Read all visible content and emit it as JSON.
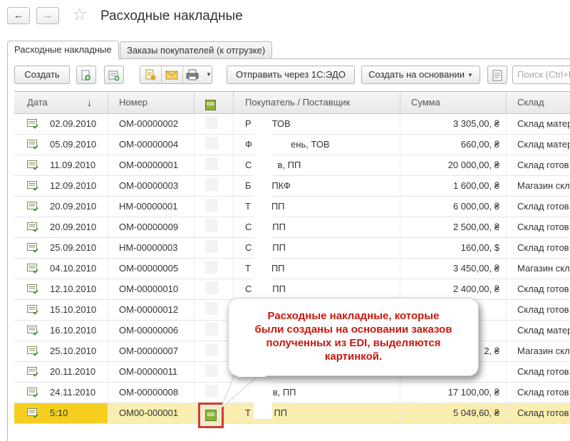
{
  "window": {
    "title": "Расходные накладные",
    "back_icon": "arrow-left-icon",
    "forward_icon": "arrow-right-icon",
    "favorite_icon": "star-icon"
  },
  "tabs": [
    {
      "label": "Расходные накладные",
      "active": true
    },
    {
      "label": "Заказы покупателей (к отгрузке)",
      "active": false
    }
  ],
  "toolbar": {
    "create_label": "Создать",
    "send_label": "Отправить через 1С:ЭДО",
    "create_based_label": "Создать на основании",
    "search_placeholder": "Поиск (Ctrl+F)"
  },
  "table": {
    "columns": [
      "Дата",
      "Номер",
      "EDI",
      "Покупатель / Поставщик",
      "Сумма",
      "Склад"
    ],
    "sort_indicator": "↓",
    "rows": [
      {
        "date": "02.09.2010",
        "number": "ОМ-00000002",
        "buyer": "Р        ТОВ",
        "sum": "3 305,00, ₴",
        "warehouse": "Склад матер",
        "edi": false
      },
      {
        "date": "05.09.2010",
        "number": "ОМ-00000004",
        "buyer": "Ф               ень, ТОВ",
        "sum": "660,00, ₴",
        "warehouse": "Склад матер",
        "edi": false
      },
      {
        "date": "11.09.2010",
        "number": "ОМ-00000001",
        "buyer": "С          в, ПП",
        "sum": "20 000,00, ₴",
        "warehouse": "Склад готов",
        "edi": false
      },
      {
        "date": "12.09.2010",
        "number": "ОМ-00000003",
        "buyer": "Б        ПКФ",
        "sum": "1 600,00, ₴",
        "warehouse": "Магазин скл",
        "edi": false
      },
      {
        "date": "20.09.2010",
        "number": "НМ-00000001",
        "buyer": "Т        ПП",
        "sum": "6 000,00, ₴",
        "warehouse": "Склад готов",
        "edi": false
      },
      {
        "date": "20.09.2010",
        "number": "ОМ-00000009",
        "buyer": "С        ПП",
        "sum": "2 500,00, ₴",
        "warehouse": "Склад готов",
        "edi": false
      },
      {
        "date": "25.09.2010",
        "number": "НМ-00000003",
        "buyer": "С        ПП",
        "sum": "160,00, $",
        "warehouse": "Склад готов",
        "edi": false
      },
      {
        "date": "04.10.2010",
        "number": "ОМ-00000005",
        "buyer": "Т        ПП",
        "sum": "3 450,00, ₴",
        "warehouse": "Магазин скл",
        "edi": false
      },
      {
        "date": "12.10.2010",
        "number": "ОМ-00000010",
        "buyer": "С        ПП",
        "sum": "2 400,00, ₴",
        "warehouse": "Склад готов",
        "edi": false
      },
      {
        "date": "15.10.2010",
        "number": "ОМ-00000012",
        "buyer": "",
        "sum": "",
        "warehouse": "Склад готов",
        "edi": false
      },
      {
        "date": "16.10.2010",
        "number": "ОМ-00000006",
        "buyer": "",
        "sum": "",
        "warehouse": "Склад матер",
        "edi": false
      },
      {
        "date": "25.10.2010",
        "number": "ОМ-00000007",
        "buyer": "",
        "sum": "2, ₴",
        "warehouse": "Магазин скл",
        "edi": false
      },
      {
        "date": "20.11.2010",
        "number": "ОМ-00000011",
        "buyer": "",
        "sum": "",
        "warehouse": "Склад готов",
        "edi": false
      },
      {
        "date": "24.11.2010",
        "number": "ОМ-00000008",
        "buyer": "        вів, ПП",
        "sum": "17 100,00, ₴",
        "warehouse": "Склад готов",
        "edi": false
      },
      {
        "date": "5:10",
        "number": "ОМ00-000001",
        "buyer": "Т         ПП",
        "sum": "5 049,60, ₴",
        "warehouse": "Склад готов",
        "edi": true,
        "selected": true
      }
    ]
  },
  "callout": {
    "lines": [
      "Расходные накладные, которые",
      "были созданы на основании заказов",
      "полученных из EDI, выделяются",
      "картинкой."
    ]
  },
  "colors": {
    "selected_row": "#f9eeb0",
    "selected_date_cell": "#f6cf1e",
    "callout_text": "#c8180e",
    "highlight_border": "#d23a35",
    "edi_badge": "#8db23a"
  }
}
